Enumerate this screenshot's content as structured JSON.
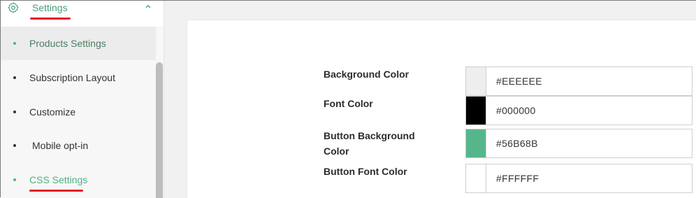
{
  "sidebar": {
    "section_label": "Settings",
    "items": [
      {
        "label": "Products Settings"
      },
      {
        "label": "Subscription Layout"
      },
      {
        "label": "Customize"
      },
      {
        "label": "Mobile opt-in"
      },
      {
        "label": "CSS Settings"
      }
    ]
  },
  "form": {
    "fields": [
      {
        "label": "Background Color",
        "value": "#EEEEEE"
      },
      {
        "label": "Font Color",
        "value": "#000000"
      },
      {
        "label": "Button Background Color",
        "value": "#56B68B"
      },
      {
        "label": "Button Font Color",
        "value": "#FFFFFF"
      }
    ]
  },
  "colors": {
    "accent_green": "#4fb183",
    "highlight_underline": "#e0202a"
  },
  "icons": {
    "settings": "gear-icon",
    "collapse": "chevron-up-icon"
  }
}
